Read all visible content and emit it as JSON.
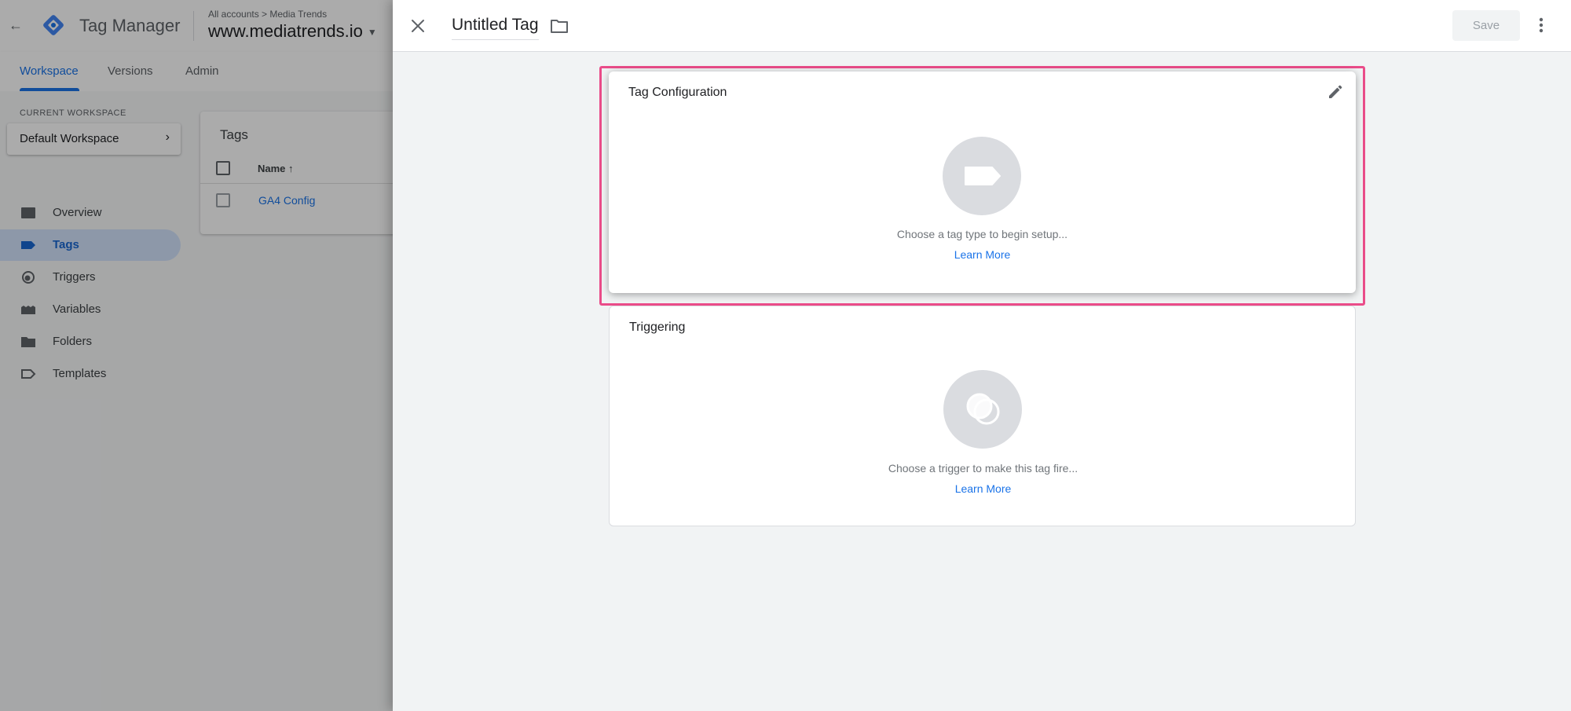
{
  "app": {
    "back_icon": "back-arrow-icon",
    "product_name": "Tag Manager",
    "breadcrumb": "All accounts > Media Trends",
    "container_name": "www.mediatrends.io",
    "tabs": [
      {
        "label": "Workspace",
        "active": true
      },
      {
        "label": "Versions",
        "active": false
      },
      {
        "label": "Admin",
        "active": false
      }
    ],
    "workspace": {
      "section_label": "CURRENT WORKSPACE",
      "name": "Default Workspace"
    },
    "sidebar": [
      {
        "label": "Overview",
        "icon": "overview-icon",
        "active": false
      },
      {
        "label": "Tags",
        "icon": "tag-icon",
        "active": true
      },
      {
        "label": "Triggers",
        "icon": "trigger-icon",
        "active": false
      },
      {
        "label": "Variables",
        "icon": "variables-icon",
        "active": false
      },
      {
        "label": "Folders",
        "icon": "folder-icon",
        "active": false
      },
      {
        "label": "Templates",
        "icon": "template-icon",
        "active": false
      }
    ],
    "tags_list": {
      "title": "Tags",
      "column_name": "Name ↑",
      "rows": [
        {
          "name": "GA4 Config"
        }
      ]
    }
  },
  "editor": {
    "title": "Untitled Tag",
    "save_label": "Save",
    "tag_configuration": {
      "title": "Tag Configuration",
      "hint": "Choose a tag type to begin setup...",
      "learn_more": "Learn More"
    },
    "triggering": {
      "title": "Triggering",
      "hint": "Choose a trigger to make this tag fire...",
      "learn_more": "Learn More"
    }
  },
  "colors": {
    "accent": "#1a73e8",
    "highlight": "#ea4c89",
    "active_nav_bg": "#d2e3fc",
    "panel_bg": "#f1f3f4",
    "placeholder_circle": "#dadce0"
  }
}
